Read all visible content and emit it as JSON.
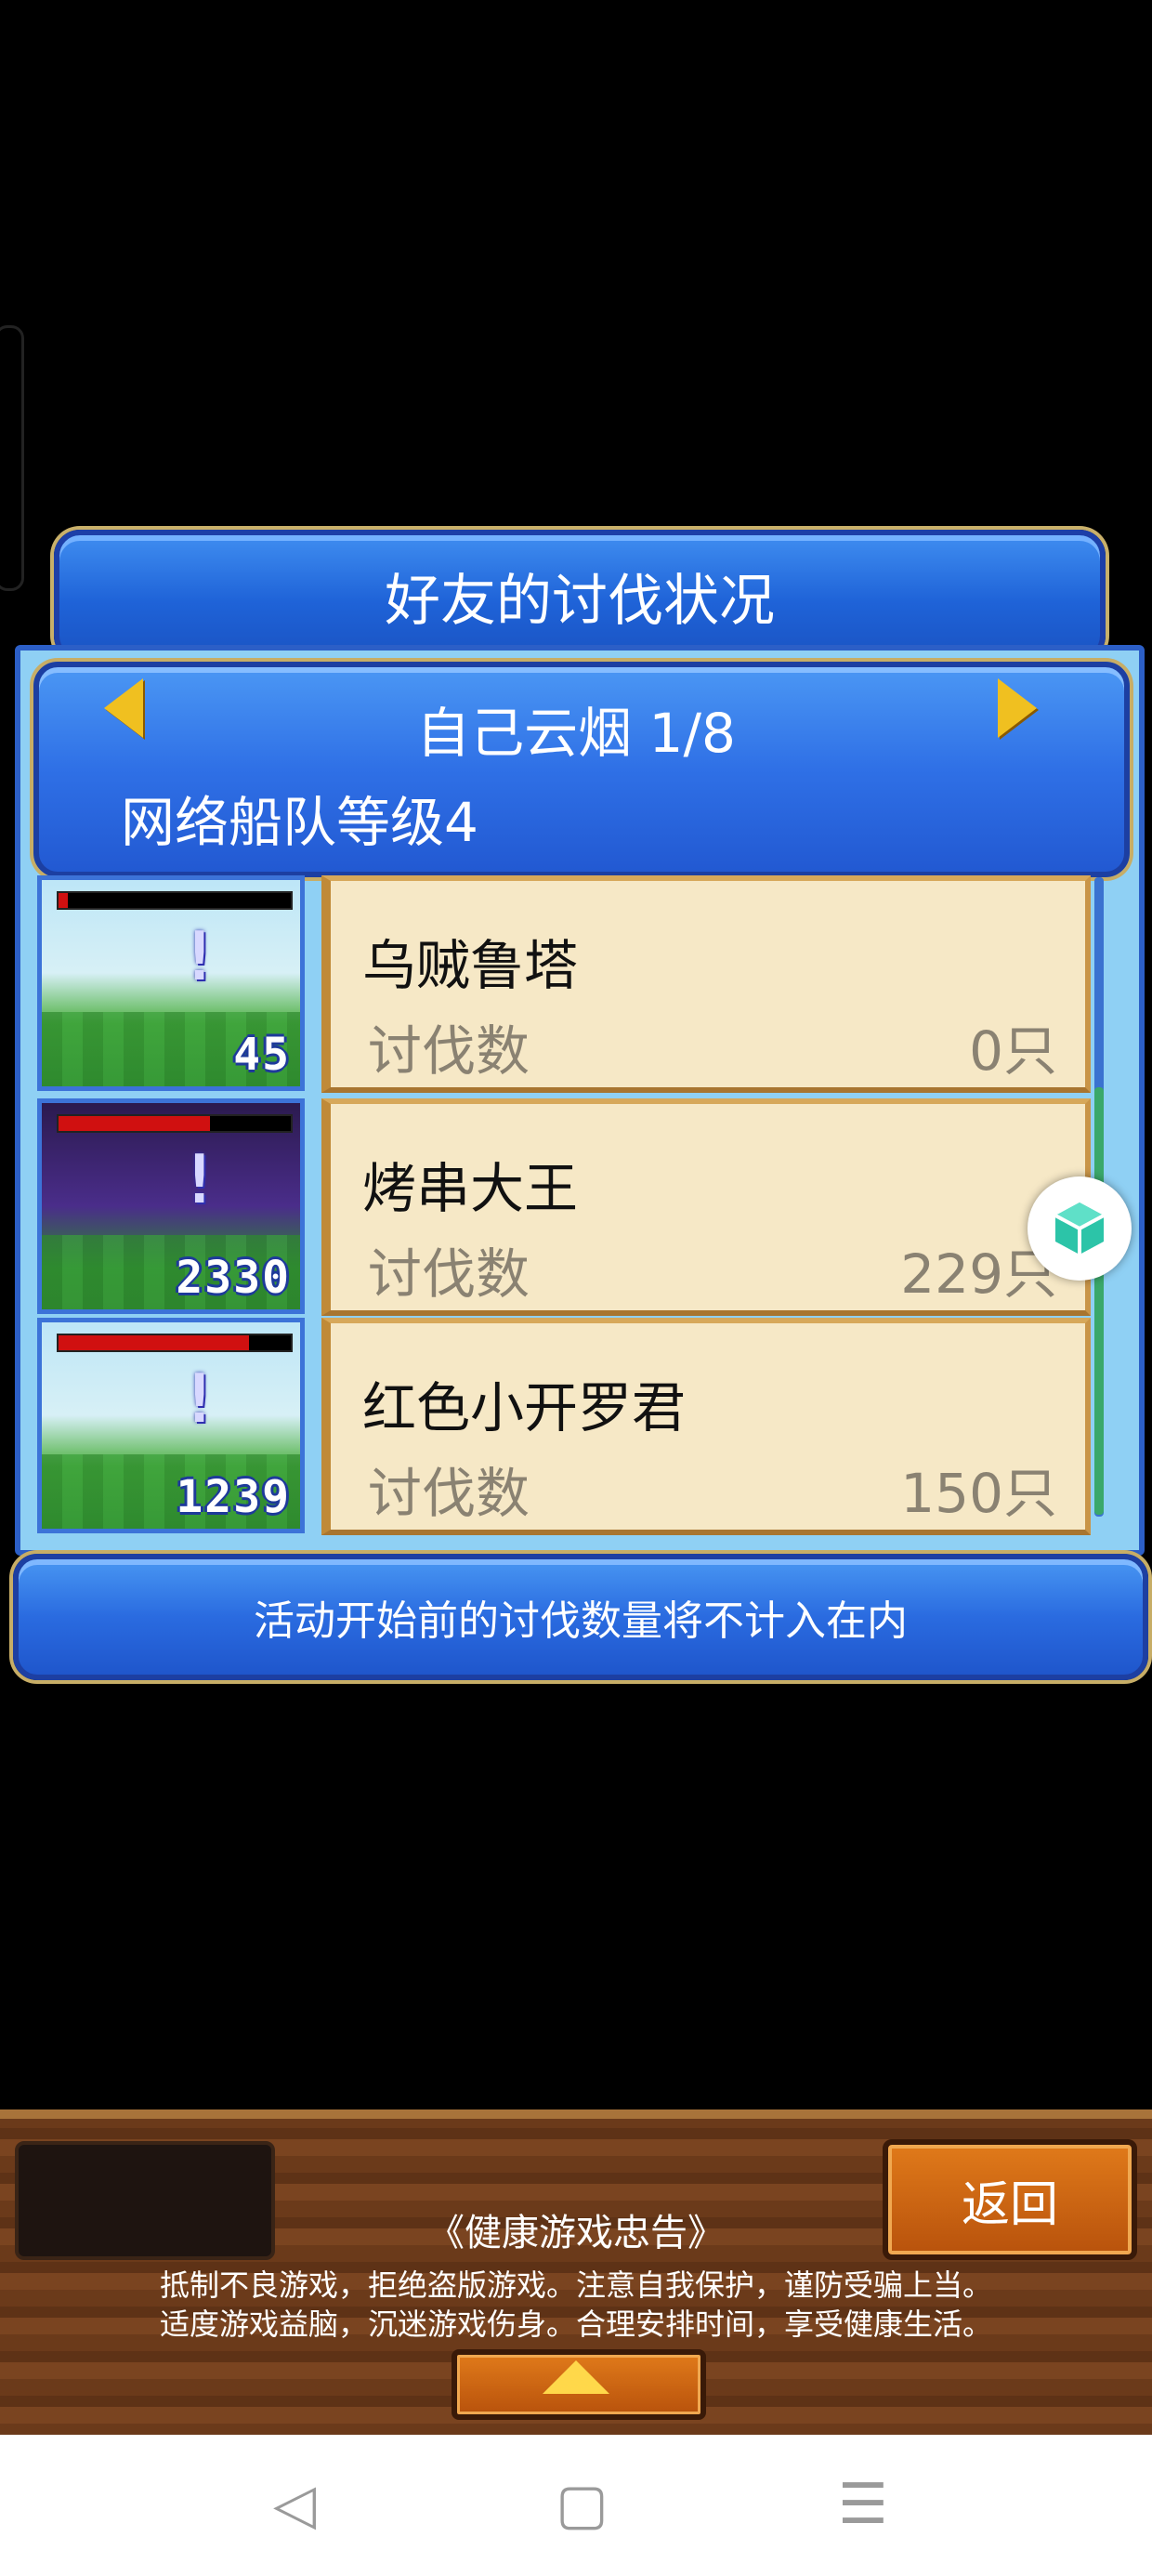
{
  "title": "好友的讨伐状况",
  "player": {
    "name_line": "自己云烟 1/8",
    "fleet_level": "网络船队等级4"
  },
  "friends": [
    {
      "name": "乌贼鲁塔",
      "label": "讨伐数",
      "count": "0只",
      "score": "45",
      "hp_color": "#d01010",
      "hp_fraction": 0.04
    },
    {
      "name": "烤串大王",
      "label": "讨伐数",
      "count": "229只",
      "score": "2330",
      "hp_color": "#d01010",
      "hp_fraction": 0.65
    },
    {
      "name": "红色小开罗君",
      "label": "讨伐数",
      "count": "150只",
      "score": "1239",
      "hp_color": "#d01010",
      "hp_fraction": 0.82
    }
  ],
  "notice": "活动开始前的讨伐数量将不计入在内",
  "footer": {
    "back_label": "返回",
    "health_title": "《健康游戏忠告》",
    "health_line1": "抵制不良游戏，拒绝盗版游戏。注意自我保护，谨防受骗上当。",
    "health_line2": "适度游戏益脑，沉迷游戏伤身。合理安排时间，享受健康生活。"
  },
  "system_nav": {
    "back_icon": "◁",
    "home_icon": "▢",
    "menu_icon": "☰"
  }
}
